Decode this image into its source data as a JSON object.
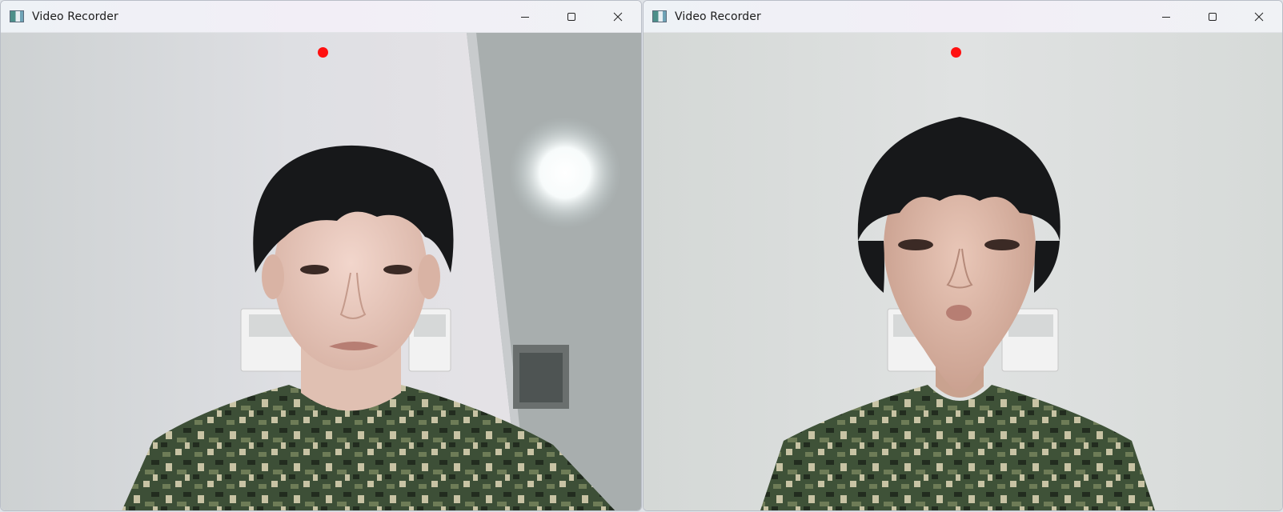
{
  "windows": [
    {
      "title": "Video Recorder",
      "frame_variant": "original"
    },
    {
      "title": "Video Recorder",
      "frame_variant": "distorted"
    }
  ],
  "colors": {
    "record_indicator": "#ff1010",
    "camouflage_dark": "#3f5238",
    "camouflage_light": "#c8c3a4",
    "wall": "#dcdfe0"
  },
  "icons": {
    "app": "app-icon",
    "minimize": "minimize-icon",
    "maximize": "maximize-icon",
    "close": "close-icon"
  }
}
